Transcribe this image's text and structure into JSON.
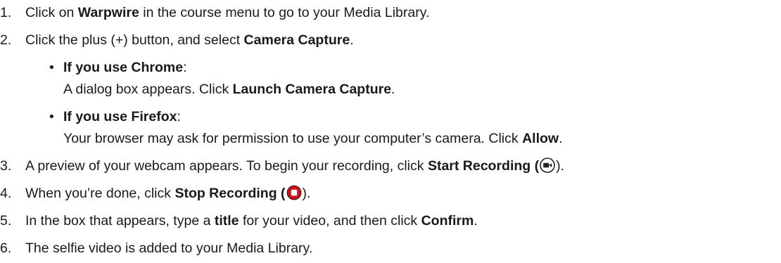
{
  "steps": [
    {
      "number": "1.",
      "pre": "Click on ",
      "bold": "Warpwire",
      "post": " in the course menu to go to your Media Library."
    },
    {
      "number": "2.",
      "pre": "Click the plus (+) button, and select ",
      "bold": "Camera Capture",
      "post": ".",
      "sub": [
        {
          "bullet": "•",
          "heading_bold": "If you use Chrome",
          "heading_post": ":",
          "detail_pre": "A dialog box appears. Click ",
          "detail_bold": "Launch Camera Capture",
          "detail_post": "."
        },
        {
          "bullet": "•",
          "heading_bold": "If you use Firefox",
          "heading_post": ":",
          "detail_pre": "Your browser may ask for permission to use your computer’s camera. Click ",
          "detail_bold": "Allow",
          "detail_post": "."
        }
      ]
    },
    {
      "number": "3.",
      "pre": "A preview of your webcam appears. To begin your recording, click ",
      "bold": "Start Recording",
      "paren_open": " (",
      "paren_close": ").",
      "icon": "video-camera-icon"
    },
    {
      "number": "4.",
      "pre": "When you’re done, click ",
      "bold": "Stop Recording",
      "paren_open": " (",
      "paren_close": ").",
      "icon": "stop-record-icon"
    },
    {
      "number": "5.",
      "pre": "In the box that appears, type a ",
      "bold": "title",
      "mid": " for your video, and then click ",
      "bold2": "Confirm",
      "post": "."
    },
    {
      "number": "6.",
      "pre": "The selfie video is added to your Media Library."
    }
  ],
  "colors": {
    "text": "#1a1a1a",
    "record_red": "#c8141e",
    "record_dark": "#5a0a0a",
    "camera_dark": "#222222"
  }
}
